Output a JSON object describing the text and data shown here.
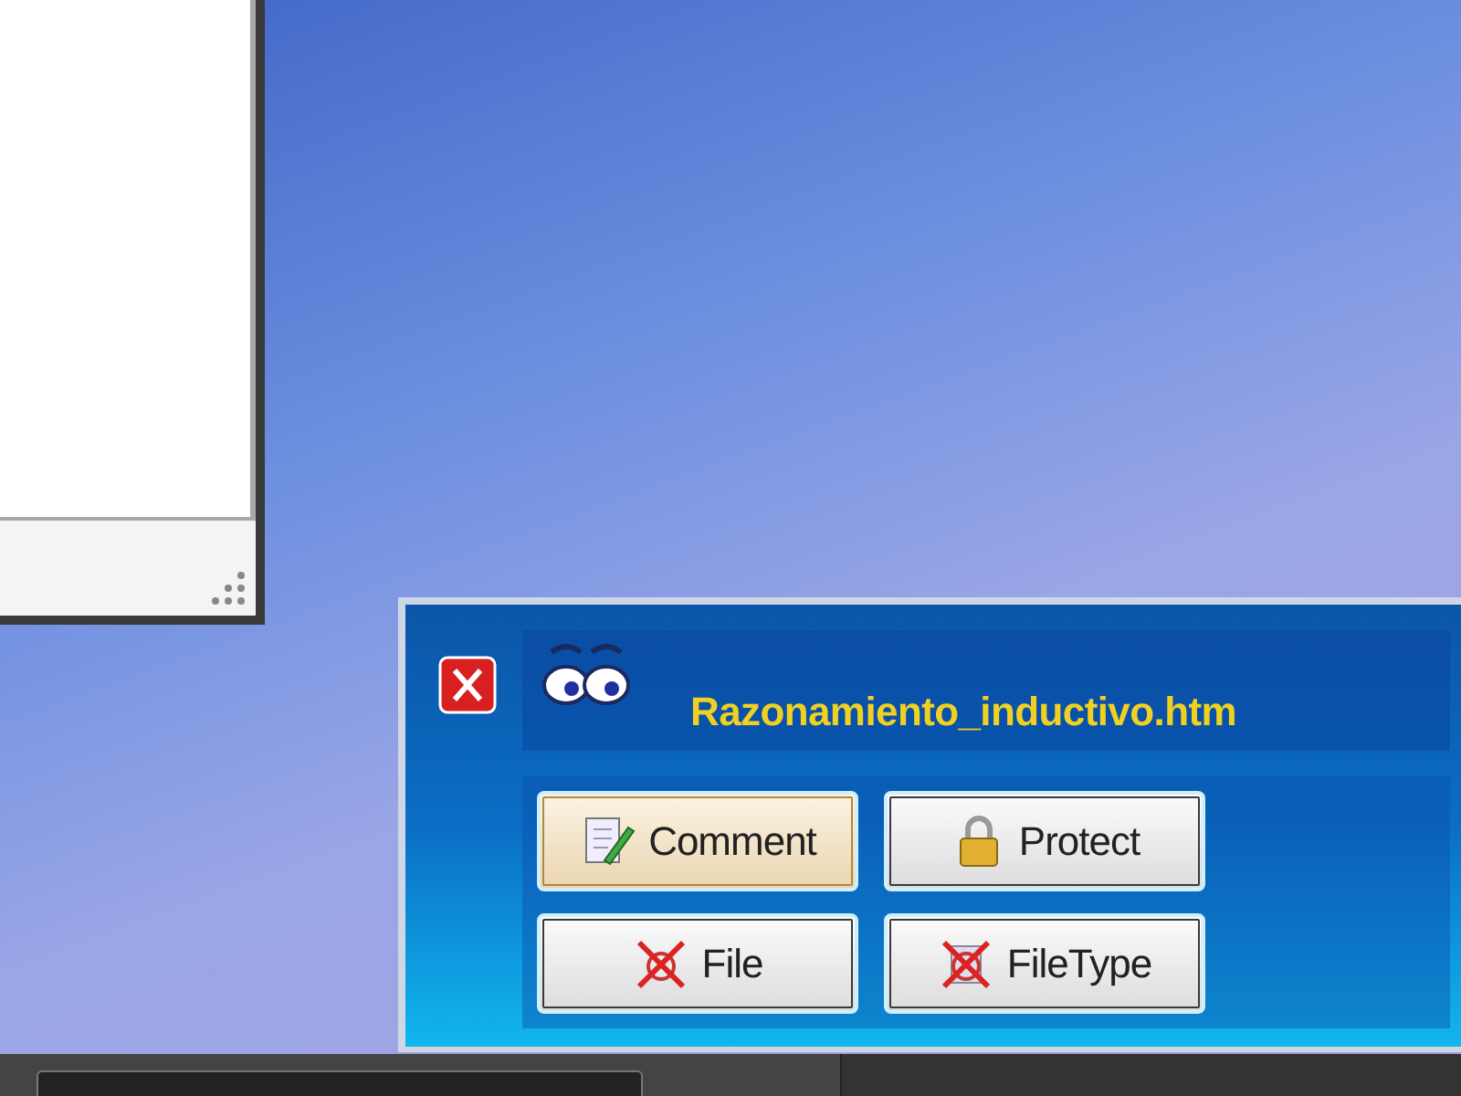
{
  "popup": {
    "title": "Razonamiento_inductivo.htm",
    "buttons": [
      {
        "label": "Comment",
        "kind": "comment",
        "focused": true
      },
      {
        "label": "Protect",
        "kind": "protect",
        "focused": false
      },
      {
        "label": "File",
        "kind": "file",
        "focused": false
      },
      {
        "label": "FileType",
        "kind": "filetype",
        "focused": false
      }
    ]
  }
}
